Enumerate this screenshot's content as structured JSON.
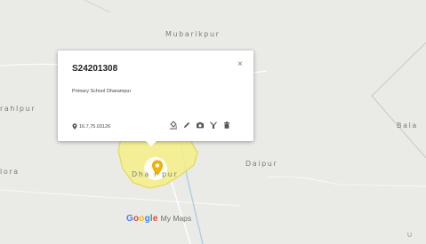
{
  "map": {
    "place_labels": {
      "mubarikpur": "Mubarikpur",
      "rahlpur": "rahlpur",
      "bala": "Bala",
      "lora": "lora",
      "dharampur": "Dha r  pur",
      "daipur": "Daipur"
    },
    "corner_text": "U",
    "colors": {
      "background": "#eaeae6",
      "boundary_fill": "#f6f089",
      "boundary_stroke": "#e6d94a",
      "marker": "#f4b400",
      "road": "#ffffff",
      "water": "#a9cce6"
    }
  },
  "popup": {
    "title": "S24201308",
    "description": "Primary School Dharampur",
    "coordinates": "16.7,75.03126",
    "close_glyph": "×",
    "actions": [
      {
        "name": "paint-bucket-icon",
        "glyph": "🎨"
      },
      {
        "name": "pencil-icon",
        "glyph": "✎"
      },
      {
        "name": "camera-icon",
        "glyph": "📷"
      },
      {
        "name": "filter-icon",
        "glyph": "⛛"
      },
      {
        "name": "trash-icon",
        "glyph": "🗑"
      }
    ]
  },
  "branding": {
    "google": "Google",
    "mymaps": "My Maps",
    "google_colors": [
      "#4285f4",
      "#ea4335",
      "#fbbc05",
      "#4285f4",
      "#34a853",
      "#ea4335"
    ]
  }
}
